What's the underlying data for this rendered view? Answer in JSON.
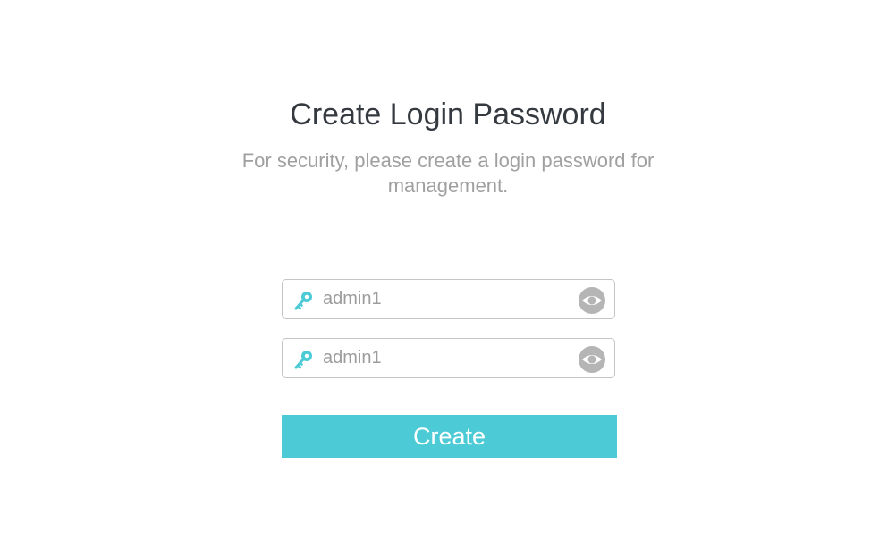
{
  "header": {
    "title": "Create Login Password",
    "subtitle": "For security, please create a login password for management."
  },
  "form": {
    "password": {
      "value": "admin1",
      "icon": "key-icon",
      "toggle_icon": "eye-icon"
    },
    "confirm_password": {
      "value": "admin1",
      "icon": "key-icon",
      "toggle_icon": "eye-icon"
    },
    "submit_label": "Create"
  },
  "colors": {
    "accent": "#4ccbd6",
    "title": "#343a40",
    "muted": "#a0a0a0",
    "border": "#c4c4c4",
    "eye_icon": "#b5b5b5"
  }
}
